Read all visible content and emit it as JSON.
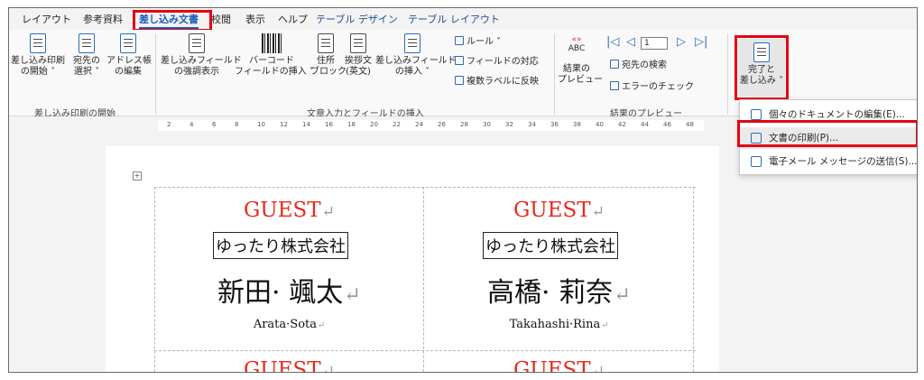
{
  "tabs": [
    "レイアウト",
    "参考資料",
    "差し込み文書",
    "校閲",
    "表示",
    "ヘルプ",
    "テーブル デザイン",
    "テーブル レイアウト"
  ],
  "ribbon": {
    "start_group": {
      "buttons": [
        {
          "line1": "差し込み印刷",
          "line2": "の開始 ˅",
          "icon": "mail-merge-start-icon"
        },
        {
          "line1": "宛先の",
          "line2": "選択 ˅",
          "icon": "select-recipients-icon"
        },
        {
          "line1": "アドレス帳",
          "line2": "の編集",
          "icon": "edit-address-book-icon"
        }
      ],
      "label": "差し込み印刷の開始"
    },
    "insert_group": {
      "buttons": [
        {
          "line1": "差し込みフィールド",
          "line2": "の強調表示",
          "icon": "highlight-fields-icon"
        },
        {
          "line1": "バーコード",
          "line2": "フィールドの挿入 ˅",
          "icon": "barcode-icon"
        },
        {
          "line1": "住所",
          "line2": "ブロック",
          "icon": "address-block-icon"
        },
        {
          "line1": "挨拶文",
          "line2": "(英文)",
          "icon": "greeting-line-icon"
        },
        {
          "line1": "差し込みフィールド",
          "line2": "の挿入 ˅",
          "icon": "insert-merge-field-icon"
        }
      ],
      "small": [
        "ルール ˅",
        "フィールドの対応",
        "複数ラベルに反映"
      ],
      "label": "文章入力とフィールドの挿入"
    },
    "preview_group": {
      "abc_text": "ABC",
      "preview_button": {
        "line1": "結果の",
        "line2": "プレビュー"
      },
      "record_value": "1",
      "small": [
        "宛先の検索",
        "エラーのチェック"
      ],
      "label": "結果のプレビュー"
    },
    "finish_button": {
      "line1": "完了と",
      "line2": "差し込み ˅"
    }
  },
  "ruler_ticks": [
    "2",
    "4",
    "6",
    "8",
    "10",
    "12",
    "14",
    "16",
    "18",
    "20",
    "22",
    "24",
    "26",
    "28",
    "30",
    "32",
    "34",
    "36",
    "38",
    "40",
    "42",
    "44",
    "46",
    "48"
  ],
  "dropdown": {
    "items": [
      {
        "label": "個々のドキュメントの編集(E)...",
        "icon": "edit-documents-icon"
      },
      {
        "label": "文書の印刷(P)...",
        "icon": "print-documents-icon"
      },
      {
        "label": "電子メール メッセージの送信(S)...",
        "icon": "email-icon"
      }
    ]
  },
  "labels": [
    {
      "guest": "GUEST",
      "company": "ゆったり株式会社",
      "name": "新田· 颯太",
      "roman": "Arata·Sota"
    },
    {
      "guest": "GUEST",
      "company": "ゆったり株式会社",
      "name": "高橋· 莉奈",
      "roman": "Takahashi·Rina"
    },
    {
      "guest": "GUEST"
    },
    {
      "guest": "GUEST"
    }
  ],
  "colors": {
    "accent": "#185abd",
    "highlight_box": "#e60012",
    "guest_text": "#e8291c"
  }
}
